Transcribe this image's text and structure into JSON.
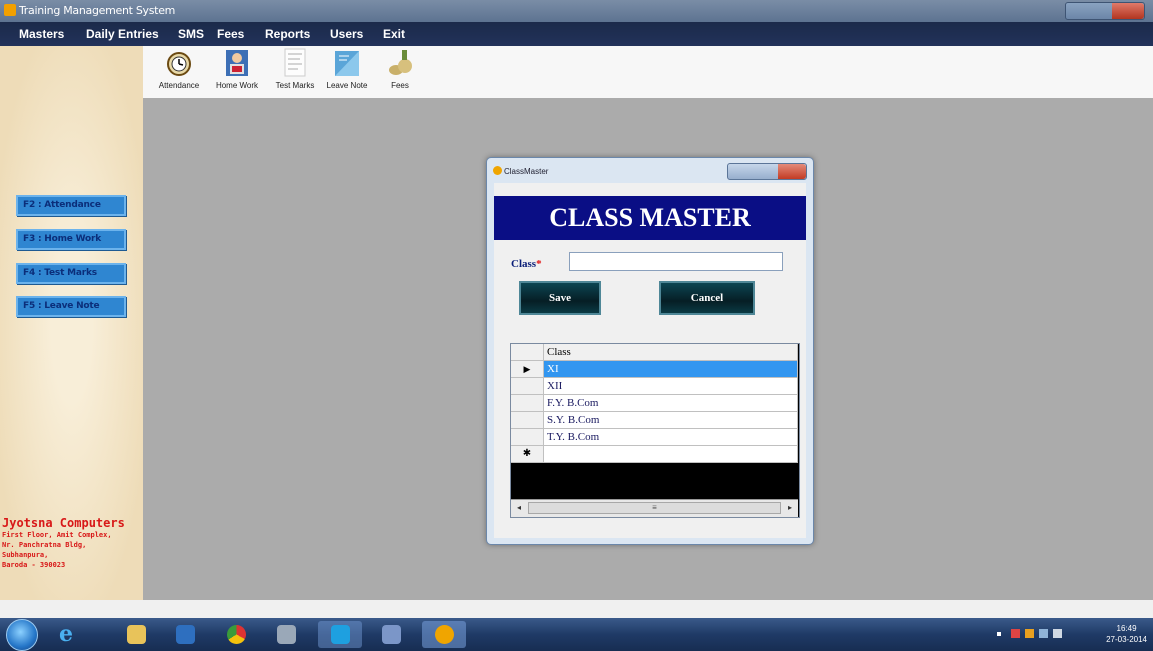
{
  "window": {
    "title": "Training Management System"
  },
  "menu": [
    "Masters",
    "Daily Entries",
    "SMS",
    "Fees",
    "Reports",
    "Users",
    "Exit"
  ],
  "toolbar": [
    {
      "label": "Attendance",
      "icon": "clock-icon"
    },
    {
      "label": "Home Work",
      "icon": "student-icon"
    },
    {
      "label": "Test Marks",
      "icon": "document-icon"
    },
    {
      "label": "Leave Note",
      "icon": "note-icon"
    },
    {
      "label": "Fees",
      "icon": "money-icon"
    }
  ],
  "sidebar": {
    "shortcuts": [
      "F2 : Attendance",
      "F3 : Home Work",
      "F4 : Test Marks",
      "F5 : Leave Note"
    ],
    "company": {
      "name": "Jyotsna Computers",
      "lines": [
        "First Floor, Amit Complex,",
        "Nr. Panchratna Bldg,",
        "Subhanpura,",
        "Baroda - 390023"
      ]
    }
  },
  "dialog": {
    "title": "ClassMaster",
    "banner": "CLASS MASTER",
    "class_label": "Class",
    "required_mark": "*",
    "class_value": "",
    "save_label": "Save",
    "cancel_label": "Cancel",
    "grid": {
      "column": "Class",
      "rows": [
        "XI",
        "XII",
        "F.Y. B.Com",
        "S.Y. B.Com",
        "T.Y. B.Com"
      ],
      "selected_row": 0
    }
  },
  "clock": {
    "time": "16:49",
    "date": "27-03-2014"
  },
  "colors": {
    "banner": "#0a0e85",
    "menubar": "#1b2a4a",
    "shortcut": "#2f86d1",
    "company_text": "#d81818",
    "selection": "#3296f0"
  }
}
